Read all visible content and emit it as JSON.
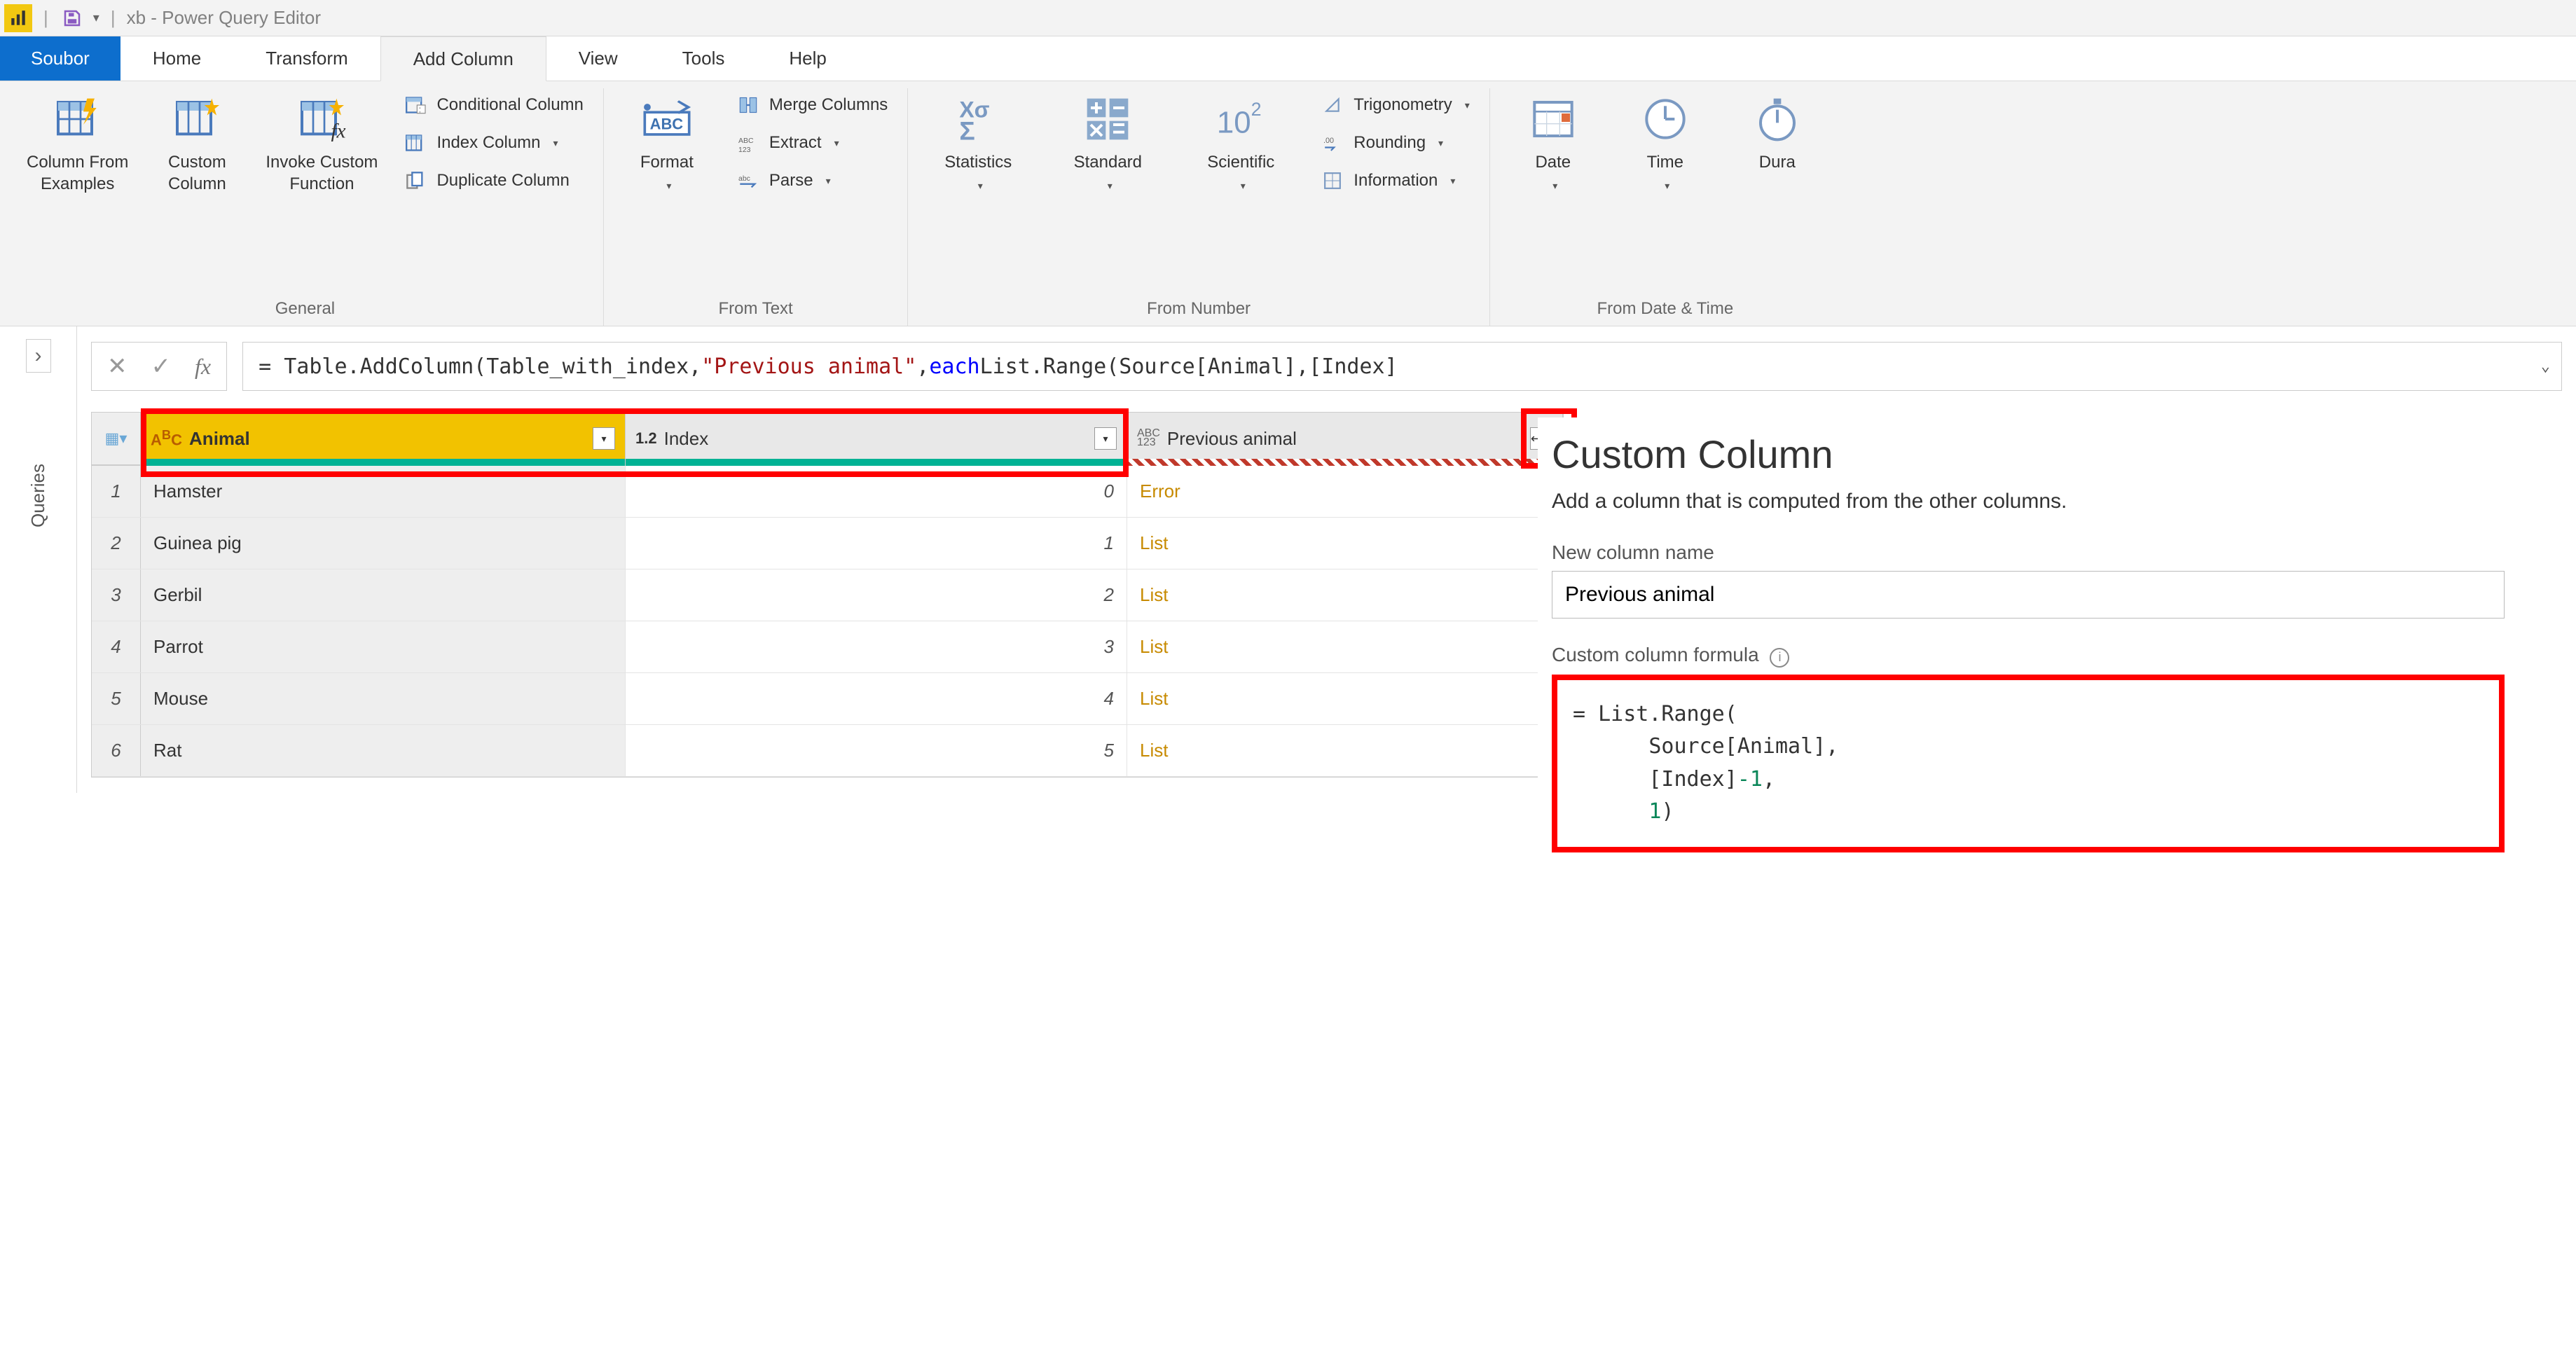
{
  "title": {
    "app_name": "xb",
    "suffix": "Power Query Editor"
  },
  "tabs": {
    "file": "Soubor",
    "items": [
      "Home",
      "Transform",
      "Add Column",
      "View",
      "Tools",
      "Help"
    ],
    "active": "Add Column"
  },
  "ribbon": {
    "groups": {
      "general": {
        "label": "General",
        "big": [
          {
            "key": "col_from_examples",
            "label": "Column From\nExamples",
            "dd": true
          },
          {
            "key": "custom_column",
            "label": "Custom\nColumn",
            "dd": false
          },
          {
            "key": "invoke_custom_fn",
            "label": "Invoke Custom\nFunction",
            "dd": false
          }
        ],
        "mini": [
          {
            "key": "conditional_column",
            "label": "Conditional Column",
            "dd": false
          },
          {
            "key": "index_column",
            "label": "Index Column",
            "dd": true
          },
          {
            "key": "duplicate_column",
            "label": "Duplicate Column",
            "dd": false
          }
        ]
      },
      "from_text": {
        "label": "From Text",
        "big": [
          {
            "key": "format",
            "label": "Format",
            "dd": true
          }
        ],
        "mini": [
          {
            "key": "merge_columns",
            "label": "Merge Columns",
            "dd": false
          },
          {
            "key": "extract",
            "label": "Extract",
            "dd": true
          },
          {
            "key": "parse",
            "label": "Parse",
            "dd": true
          }
        ]
      },
      "from_number": {
        "label": "From Number",
        "big": [
          {
            "key": "statistics",
            "label": "Statistics",
            "dd": true
          },
          {
            "key": "standard",
            "label": "Standard",
            "dd": true
          },
          {
            "key": "scientific",
            "label": "Scientific",
            "dd": true
          }
        ],
        "mini": [
          {
            "key": "trigonometry",
            "label": "Trigonometry",
            "dd": true
          },
          {
            "key": "rounding",
            "label": "Rounding",
            "dd": true
          },
          {
            "key": "information",
            "label": "Information",
            "dd": true
          }
        ]
      },
      "from_datetime": {
        "label": "From Date & Time",
        "big": [
          {
            "key": "date",
            "label": "Date",
            "dd": true
          },
          {
            "key": "time",
            "label": "Time",
            "dd": true
          },
          {
            "key": "duration",
            "label": "Dura",
            "dd": true
          }
        ]
      }
    }
  },
  "queries_rail": {
    "label": "Queries"
  },
  "formula_bar": {
    "prefix": "= Table.AddColumn(Table_with_index, ",
    "literal": "\"Previous animal\"",
    "mid1": ", ",
    "keyword": "each",
    "mid2": " List.Range(Source[Animal],[Index]"
  },
  "table": {
    "columns": [
      {
        "key": "animal",
        "label": "Animal",
        "type_icon": "ABC",
        "type_color": "#b85c00"
      },
      {
        "key": "index",
        "label": "Index",
        "type_icon": "1.2",
        "type_color": "#333"
      },
      {
        "key": "prev",
        "label": "Previous animal",
        "type_icon": "ABC123",
        "type_color": "#666",
        "expand": true
      }
    ],
    "rows": [
      {
        "n": "1",
        "animal": "Hamster",
        "index": "0",
        "prev": "Error",
        "prev_kind": "error"
      },
      {
        "n": "2",
        "animal": "Guinea pig",
        "index": "1",
        "prev": "List",
        "prev_kind": "link"
      },
      {
        "n": "3",
        "animal": "Gerbil",
        "index": "2",
        "prev": "List",
        "prev_kind": "link"
      },
      {
        "n": "4",
        "animal": "Parrot",
        "index": "3",
        "prev": "List",
        "prev_kind": "link"
      },
      {
        "n": "5",
        "animal": "Mouse",
        "index": "4",
        "prev": "List",
        "prev_kind": "link"
      },
      {
        "n": "6",
        "animal": "Rat",
        "index": "5",
        "prev": "List",
        "prev_kind": "link"
      }
    ]
  },
  "custom_column": {
    "title": "Custom Column",
    "subtitle": "Add a column that is computed from the other columns.",
    "name_label": "New column name",
    "name_value": "Previous animal",
    "formula_label": "Custom column formula",
    "formula_lines": {
      "l1a": "= List.Range(",
      "l2a": "Source[Animal],",
      "l3a": "[Index]",
      "l3b": "-1",
      "l3c": ",",
      "l4a": "1",
      "l4b": ")"
    }
  }
}
